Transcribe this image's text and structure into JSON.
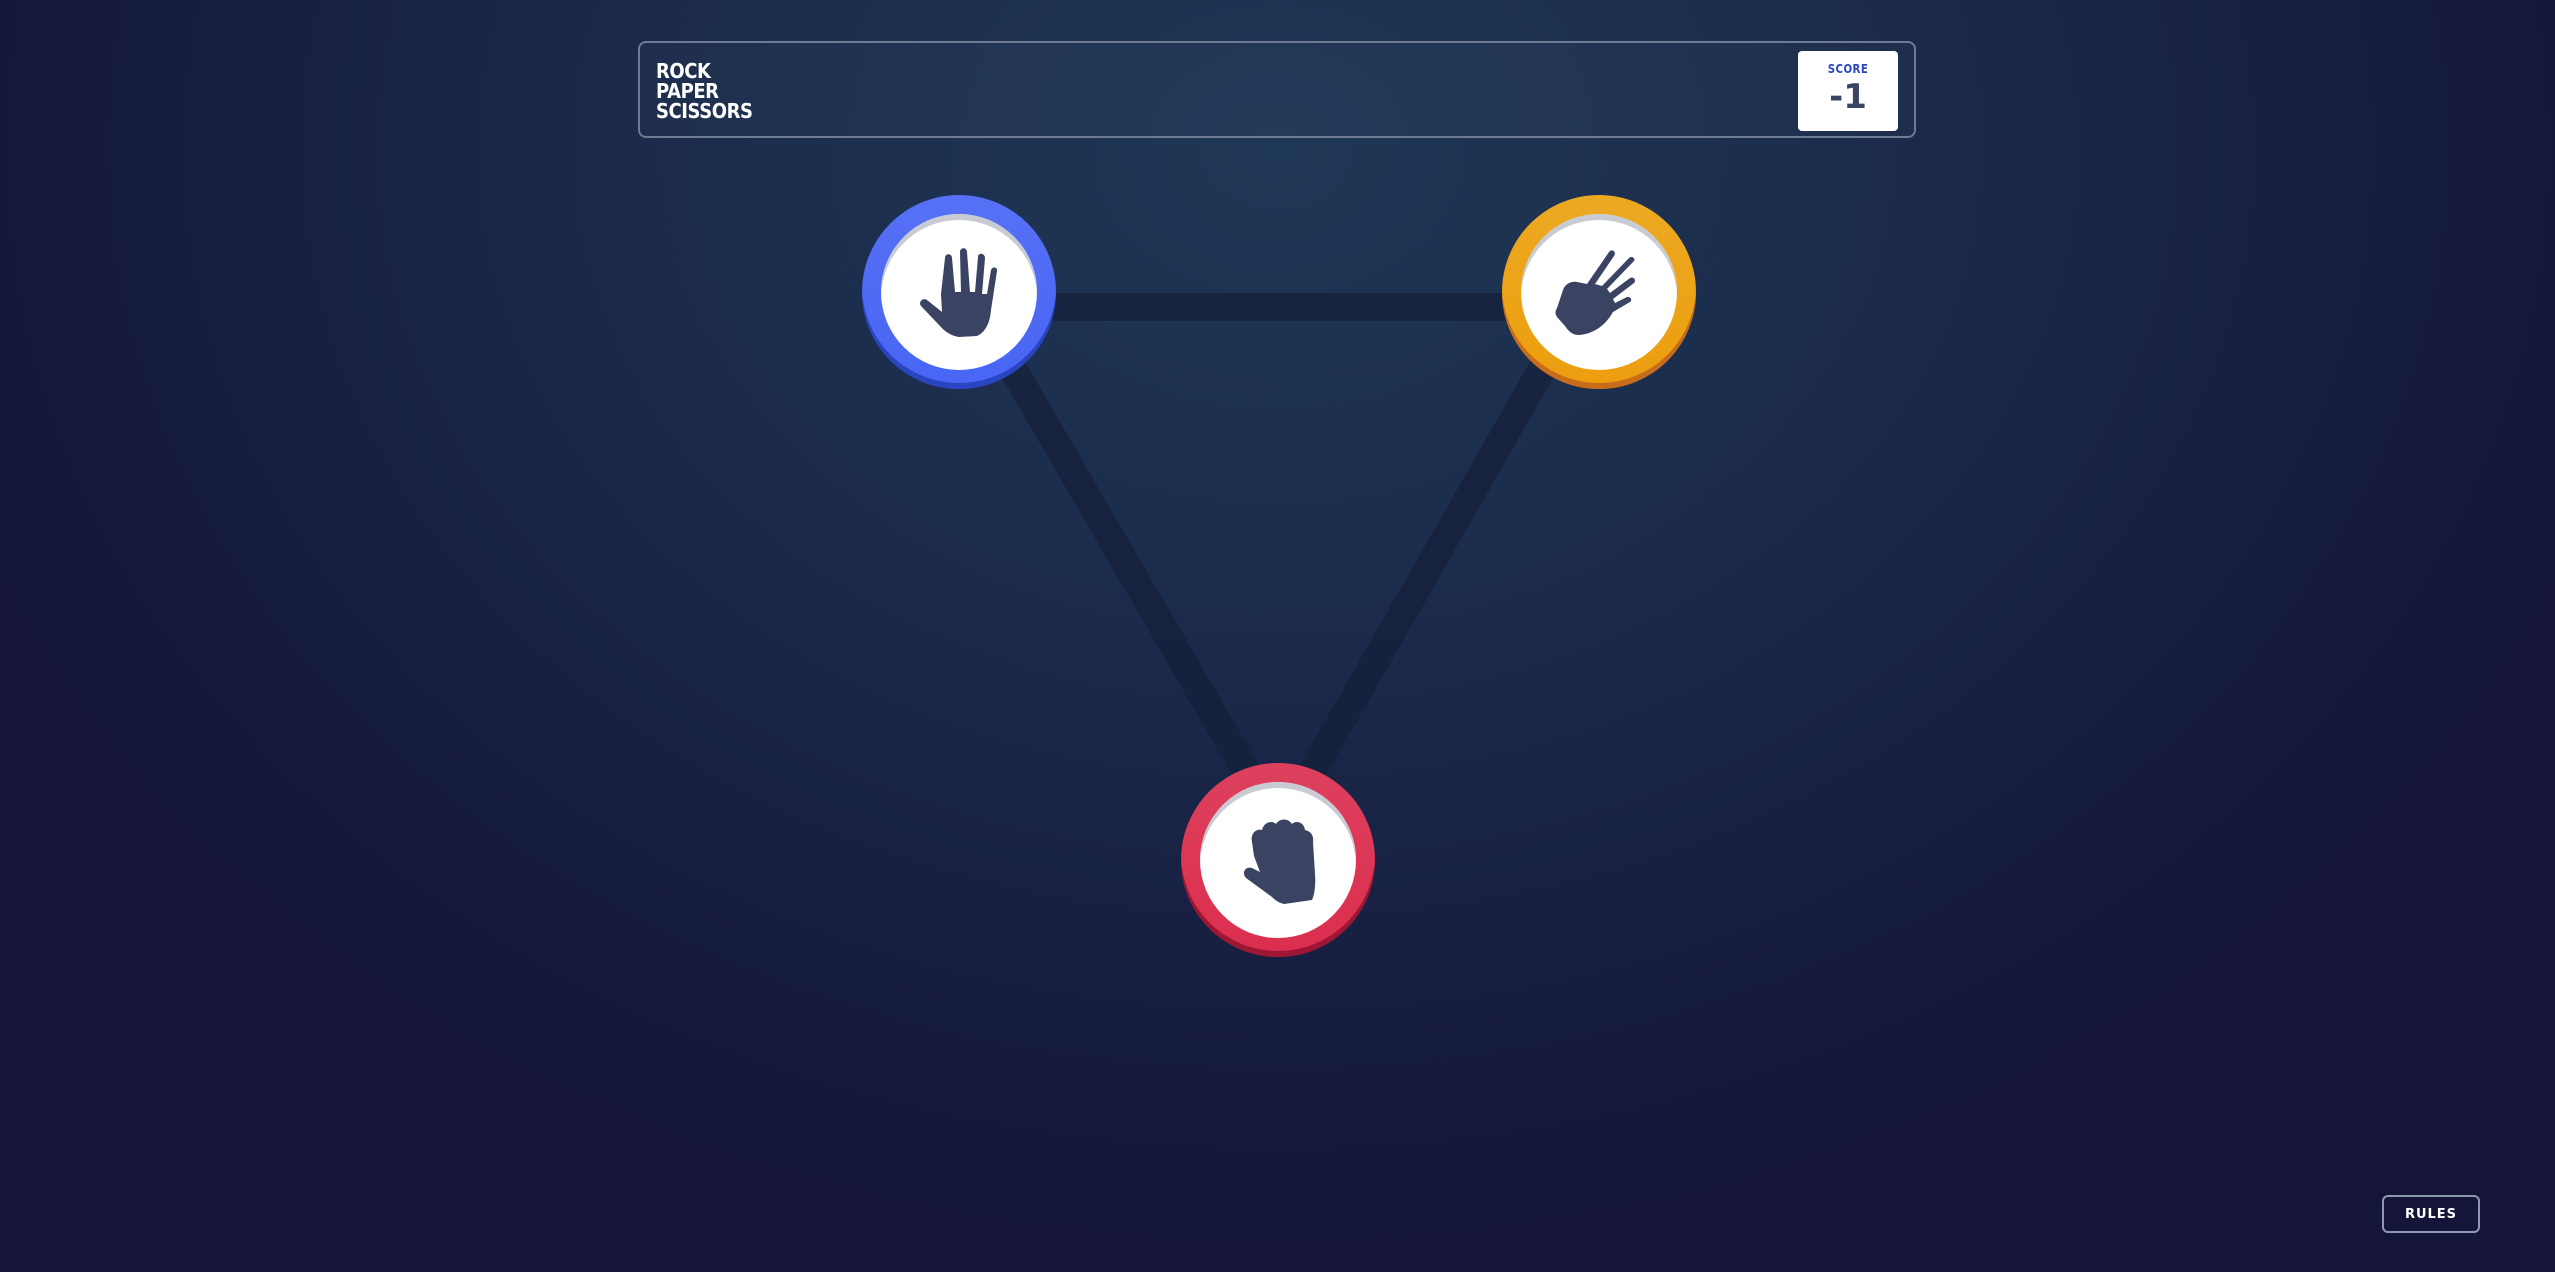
{
  "header": {
    "title_lines": [
      "ROCK",
      "PAPER",
      "SCISSORS"
    ],
    "score_label": "SCORE",
    "score_value": "-1"
  },
  "tokens": [
    {
      "name": "paper",
      "icon": "paper-hand-icon",
      "ring_color": "#4865f4"
    },
    {
      "name": "scissors",
      "icon": "scissors-hand-icon",
      "ring_color": "#ec9e0e"
    },
    {
      "name": "rock",
      "icon": "rock-fist-icon",
      "ring_color": "#dc2e4e"
    }
  ],
  "rules_button": {
    "label": "RULES"
  },
  "colors": {
    "background_top": "#1f3756",
    "background_bottom": "#141539",
    "hand_icon": "#3b4363",
    "triangle_line": "#15203a"
  }
}
